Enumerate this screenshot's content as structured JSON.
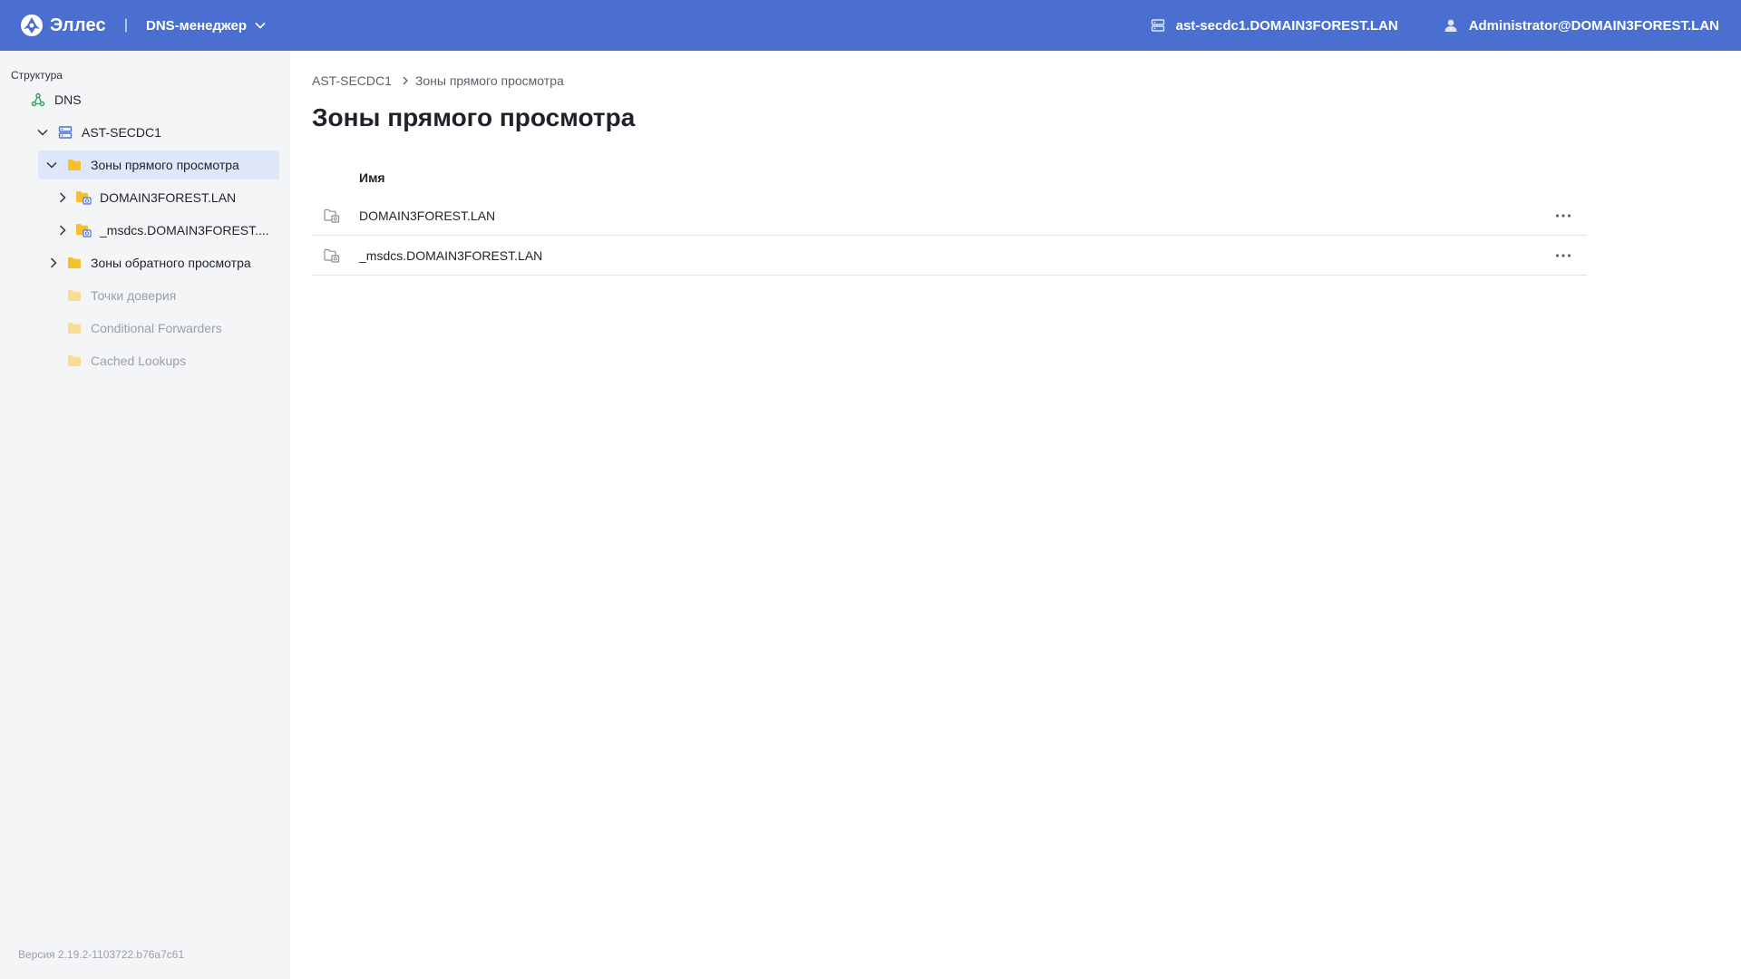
{
  "header": {
    "brand": "Эллес",
    "separator": "|",
    "app_name": "DNS-менеджер",
    "server": "ast-secdc1.DOMAIN3FOREST.LAN",
    "user": "Administrator@DOMAIN3FOREST.LAN",
    "bg_color": "#4a6fd1"
  },
  "sidebar": {
    "title": "Структура",
    "items": [
      {
        "label": "DNS",
        "icon": "dns-icon"
      },
      {
        "label": "AST-SECDC1",
        "icon": "server-icon"
      },
      {
        "label": "Зоны прямого просмотра",
        "icon": "folder-icon",
        "selected": true
      },
      {
        "label": "DOMAIN3FOREST.LAN",
        "icon": "zone-folder-icon"
      },
      {
        "label": "_msdcs.DOMAIN3FOREST....",
        "icon": "zone-folder-icon"
      },
      {
        "label": "Зоны обратного просмотра",
        "icon": "folder-icon"
      },
      {
        "label": "Точки доверия",
        "icon": "folder-icon",
        "disabled": true
      },
      {
        "label": "Conditional Forwarders",
        "icon": "folder-icon",
        "disabled": true
      },
      {
        "label": "Cached Lookups",
        "icon": "folder-icon",
        "disabled": true
      }
    ],
    "version": "Версия 2.19.2-1103722.b76a7c61"
  },
  "main": {
    "breadcrumb": [
      "AST-SECDC1",
      "Зоны прямого просмотра"
    ],
    "title": "Зоны прямого просмотра",
    "table": {
      "columns": [
        "Имя"
      ],
      "rows": [
        {
          "name": "DOMAIN3FOREST.LAN"
        },
        {
          "name": "_msdcs.DOMAIN3FOREST.LAN"
        }
      ]
    }
  }
}
